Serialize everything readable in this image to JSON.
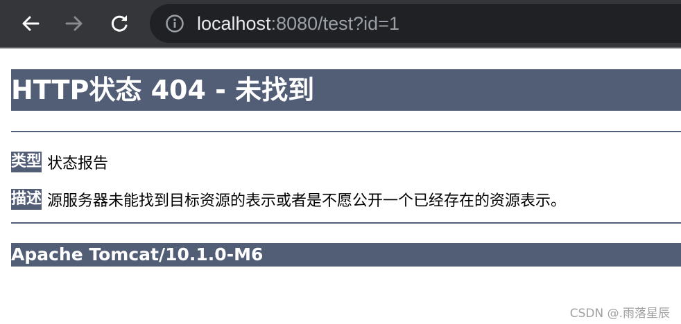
{
  "browser": {
    "url_host": "localhost",
    "url_rest": ":8080/test?id=1",
    "icons": {
      "back": "back-arrow-icon",
      "forward": "forward-arrow-icon",
      "reload": "reload-icon",
      "info": "info-icon"
    }
  },
  "page": {
    "title": "HTTP状态 404 - 未找到",
    "type_label": "类型",
    "type_value": "状态报告",
    "desc_label": "描述",
    "desc_value": "源服务器未能找到目标资源的表示或者是不愿公开一个已经存在的资源表示。",
    "footer": "Apache Tomcat/10.1.0-M6"
  },
  "watermark": "CSDN @.雨落星辰",
  "colors": {
    "accent": "#525d76",
    "toolbar": "#35363a",
    "omnibox": "#202124"
  }
}
